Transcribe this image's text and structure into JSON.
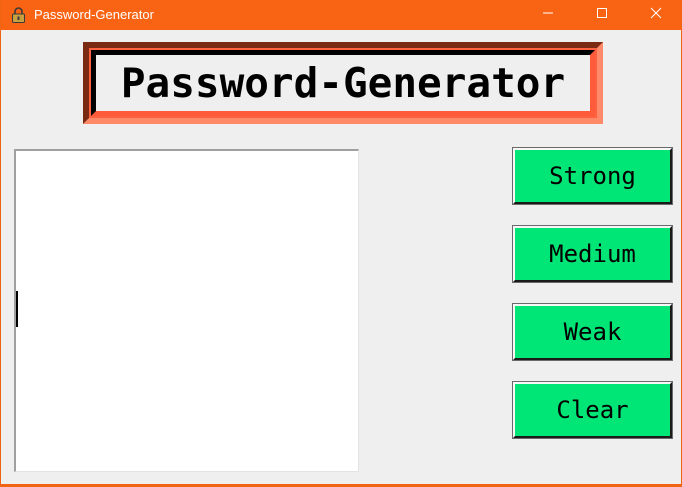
{
  "window": {
    "title": "Password-Generator",
    "accent_color": "#f86414",
    "icons": {
      "app": "lock-icon",
      "minimize": "minimize-icon",
      "maximize": "maximize-icon",
      "close": "close-icon"
    }
  },
  "header": {
    "logo_text": "Password-Generator"
  },
  "output": {
    "value": ""
  },
  "buttons": {
    "strong": "Strong",
    "medium": "Medium",
    "weak": "Weak",
    "clear": "Clear",
    "color": "#00e676"
  }
}
